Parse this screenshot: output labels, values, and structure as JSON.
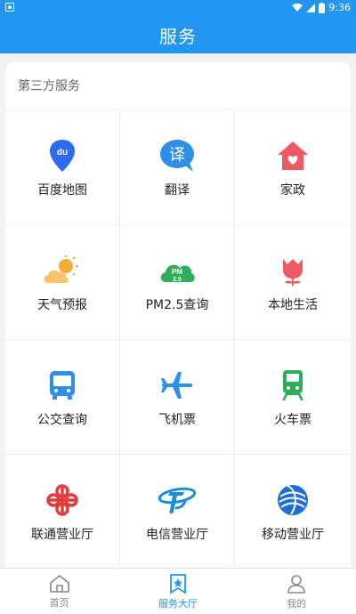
{
  "status": {
    "time": "9:36",
    "left_icon": "notification-icon"
  },
  "header": {
    "title": "服务"
  },
  "section": {
    "title": "第三方服务"
  },
  "services": [
    {
      "label": "百度地图",
      "icon": "baidu-map-icon"
    },
    {
      "label": "翻译",
      "icon": "translate-icon"
    },
    {
      "label": "家政",
      "icon": "home-service-icon"
    },
    {
      "label": "天气预报",
      "icon": "weather-icon"
    },
    {
      "label": "PM2.5查询",
      "icon": "pm25-icon"
    },
    {
      "label": "本地生活",
      "icon": "local-life-icon"
    },
    {
      "label": "公交查询",
      "icon": "bus-icon"
    },
    {
      "label": "飞机票",
      "icon": "plane-icon"
    },
    {
      "label": "火车票",
      "icon": "train-icon"
    },
    {
      "label": "联通营业厅",
      "icon": "unicom-icon"
    },
    {
      "label": "电信营业厅",
      "icon": "telecom-icon"
    },
    {
      "label": "移动营业厅",
      "icon": "mobile-icon"
    }
  ],
  "tabs": [
    {
      "label": "首页",
      "icon": "home-icon",
      "active": false
    },
    {
      "label": "服务大厅",
      "icon": "service-hall-icon",
      "active": true
    },
    {
      "label": "我的",
      "icon": "profile-icon",
      "active": false
    }
  ],
  "colors": {
    "primary": "#2196f3",
    "inactive": "#888888"
  }
}
